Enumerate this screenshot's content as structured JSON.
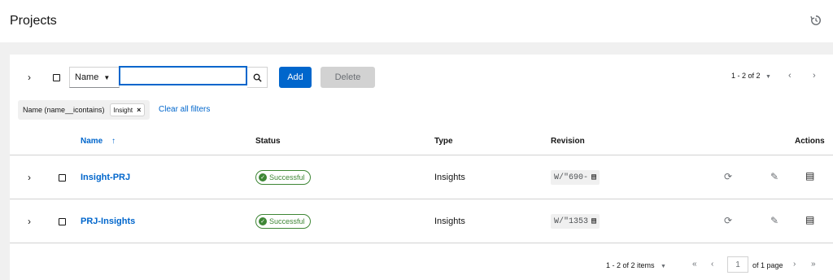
{
  "header": {
    "title": "Projects",
    "history_icon": "history-icon"
  },
  "toolbar": {
    "filter_select": "Name",
    "search_value": "",
    "add_label": "Add",
    "delete_label": "Delete",
    "pagination": "1 - 2 of 2"
  },
  "filters": {
    "category": "Name (name__icontains)",
    "chip": "Insight",
    "clear_label": "Clear all filters"
  },
  "table": {
    "columns": [
      "Name",
      "Status",
      "Type",
      "Revision",
      "Actions"
    ],
    "rows": [
      {
        "name": "Insight-PRJ",
        "status": "Successful",
        "type": "Insights",
        "revision": "W/\"690-"
      },
      {
        "name": "PRJ-Insights",
        "status": "Successful",
        "type": "Insights",
        "revision": "W/\"1353"
      }
    ]
  },
  "footer": {
    "items": "1 - 2 of 2 items",
    "page": "1",
    "of_page": "of 1 page"
  },
  "colors": {
    "primary": "#0066cc",
    "success": "#3e8635"
  }
}
